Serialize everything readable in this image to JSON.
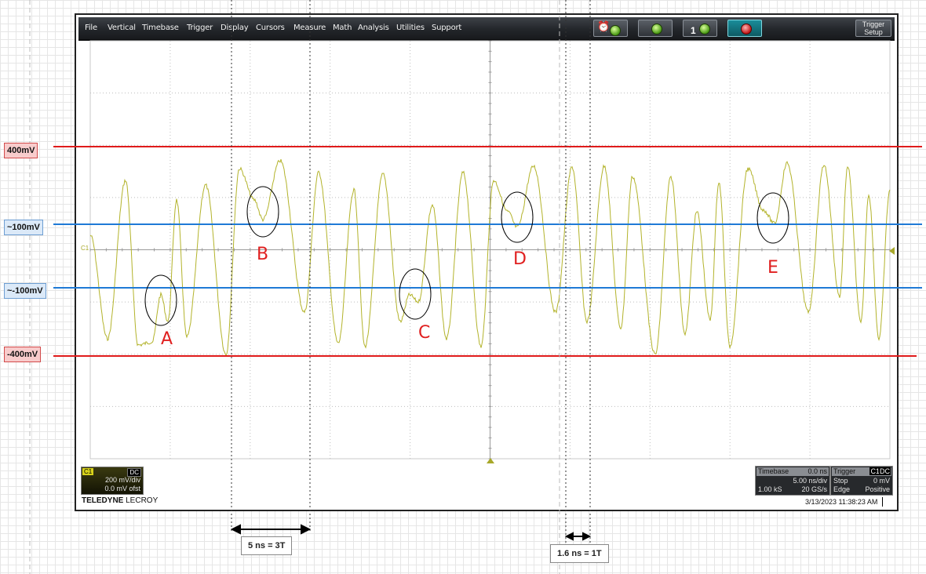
{
  "menu": [
    "File",
    "Vertical",
    "Timebase",
    "Trigger",
    "Display",
    "Cursors",
    "Measure",
    "Math",
    "Analysis",
    "Utilities",
    "Support"
  ],
  "toolbar": {
    "icons": [
      "alarm-clock-icon",
      "green-lamp-icon",
      "green-lamp-one-icon",
      "red-lamp-icon"
    ],
    "trigger_setup": "Trigger Setup",
    "badge_number": "1"
  },
  "levels": {
    "pos400": "400mV",
    "pos100": "~100mV",
    "neg100": "~-100mV",
    "neg400": "-400mV"
  },
  "channel": {
    "tag": "C1",
    "coupling": "DC",
    "scale": "200 mV/div",
    "offset": "0.0 mV ofst",
    "marker": "C1"
  },
  "brand": {
    "bold": "TELEDYNE",
    "rest": " LECROY"
  },
  "timebase": {
    "title": "Timebase",
    "delay": "0.0 ns",
    "scale": "5.00 ns/div",
    "samples": "1.00 kS",
    "rate": "20 GS/s"
  },
  "trigger": {
    "title": "Trigger",
    "channel": "C1",
    "coupling": "DC",
    "mode": "Stop",
    "level": "0 mV",
    "type": "Edge",
    "slope": "Positive"
  },
  "timestamp": "3/13/2023 11:38:23 AM",
  "annotations": {
    "period_3t": "5 ns = 3T",
    "period_1t": "1.6 ns = 1T",
    "points": [
      "A",
      "B",
      "C",
      "D",
      "E"
    ]
  },
  "colors": {
    "trace": "#b3b32b",
    "level_red": "#e01b1b",
    "level_blue": "#1f7ad6",
    "annotation": "#e02020",
    "menubar": "#24272b"
  }
}
